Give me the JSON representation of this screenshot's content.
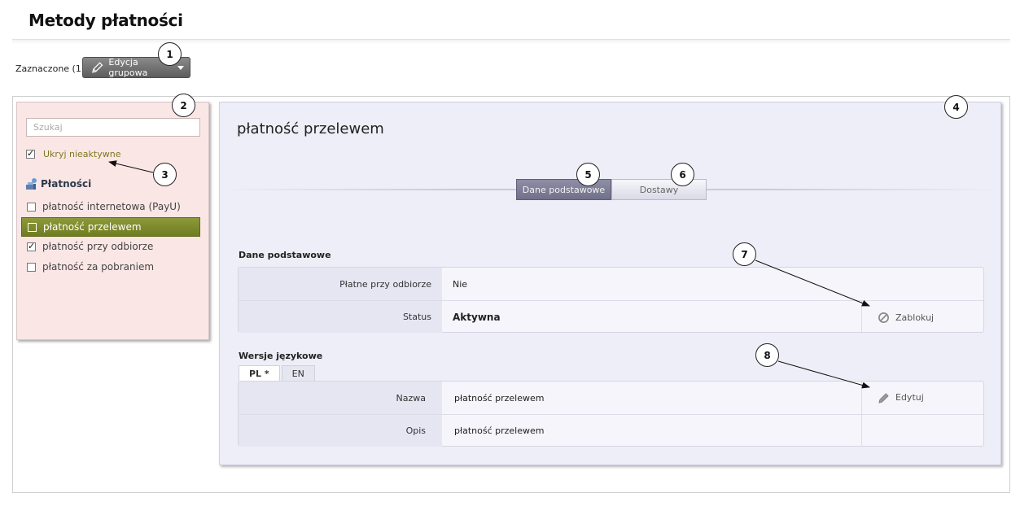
{
  "header": {
    "title": "Metody płatności"
  },
  "toolbar": {
    "selected_label": "Zaznaczone (1)",
    "group_edit_label": "Edycja grupowa"
  },
  "sidebar": {
    "search_placeholder": "Szukaj",
    "hide_inactive_label": "Ukryj nieaktywne",
    "hide_inactive_checked": true,
    "section_title": "Płatności",
    "items": [
      {
        "label": "płatność internetowa (PayU)",
        "checked": false
      },
      {
        "label": "płatność przelewem",
        "checked": false,
        "active": true
      },
      {
        "label": "płatność przy odbiorze",
        "checked": true
      },
      {
        "label": "płatność za pobraniem",
        "checked": false
      }
    ]
  },
  "main": {
    "title": "płatność przelewem",
    "tabs": [
      {
        "label": "Dane podstawowe",
        "active": true
      },
      {
        "label": "Dostawy",
        "active": false
      }
    ],
    "basic": {
      "heading": "Dane podstawowe",
      "rows": [
        {
          "label": "Płatne przy odbiorze",
          "value": "Nie"
        },
        {
          "label": "Status",
          "value": "Aktywna"
        }
      ],
      "action_label": "Zablokuj"
    },
    "lang": {
      "heading": "Wersje językowe",
      "tabs": [
        {
          "label": "PL *",
          "active": true
        },
        {
          "label": "EN",
          "active": false
        }
      ],
      "rows": [
        {
          "label": "Nazwa",
          "value": "płatność przelewem"
        },
        {
          "label": "Opis",
          "value": "płatność przelewem"
        }
      ],
      "action_label": "Edytuj"
    }
  },
  "callouts": [
    "1",
    "2",
    "3",
    "4",
    "5",
    "6",
    "7",
    "8"
  ],
  "colors": {
    "sidebar_bg": "#fbe6e6",
    "panel_bg": "#eeeef8",
    "active_item": "#7a8730",
    "hide_inactive_text": "#7a7a22"
  }
}
